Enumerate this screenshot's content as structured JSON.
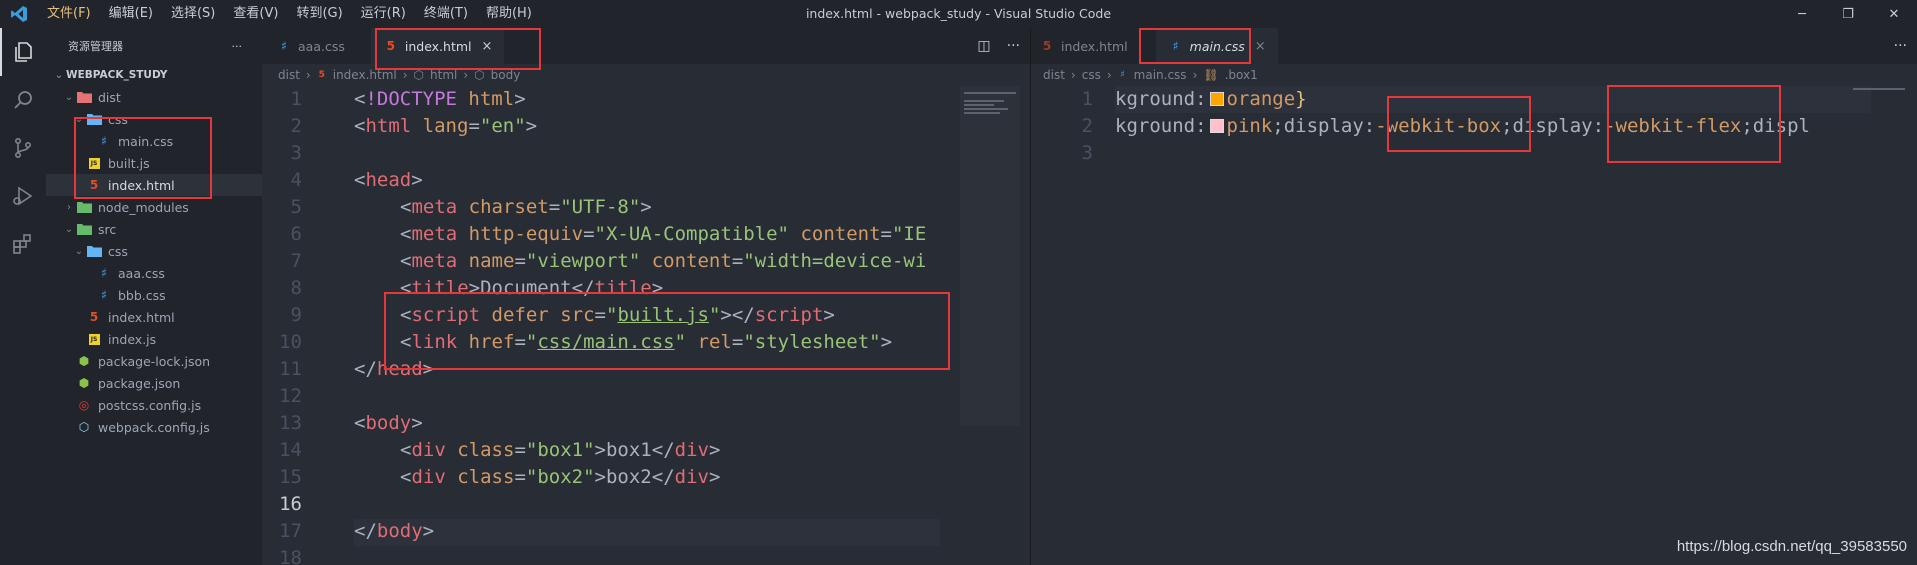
{
  "titlebar": {
    "menu": [
      "文件(F)",
      "编辑(E)",
      "选择(S)",
      "查看(V)",
      "转到(G)",
      "运行(R)",
      "终端(T)",
      "帮助(H)"
    ],
    "title": "index.html - webpack_study - Visual Studio Code"
  },
  "sidebar": {
    "header": "资源管理器",
    "more": "···",
    "folder": "WEBPACK_STUDY",
    "tree": [
      {
        "label": "dist",
        "indent": 1,
        "kind": "folder-open",
        "icon": "folder-red-icon"
      },
      {
        "label": "css",
        "indent": 2,
        "kind": "folder-open",
        "icon": "folder-blue-icon"
      },
      {
        "label": "main.css",
        "indent": 3,
        "kind": "css",
        "icon": "css-file-icon"
      },
      {
        "label": "built.js",
        "indent": 2,
        "kind": "js",
        "icon": "js-file-icon"
      },
      {
        "label": "index.html",
        "indent": 2,
        "kind": "html",
        "icon": "html-file-icon",
        "selected": true
      },
      {
        "label": "node_modules",
        "indent": 1,
        "kind": "folder-closed",
        "icon": "folder-green-icon"
      },
      {
        "label": "src",
        "indent": 1,
        "kind": "folder-open",
        "icon": "folder-green-icon"
      },
      {
        "label": "css",
        "indent": 2,
        "kind": "folder-open",
        "icon": "folder-blue-icon"
      },
      {
        "label": "aaa.css",
        "indent": 3,
        "kind": "css",
        "icon": "css-file-icon"
      },
      {
        "label": "bbb.css",
        "indent": 3,
        "kind": "css",
        "icon": "css-file-icon"
      },
      {
        "label": "index.html",
        "indent": 2,
        "kind": "html",
        "icon": "html-file-icon"
      },
      {
        "label": "index.js",
        "indent": 2,
        "kind": "js",
        "icon": "js-file-icon"
      },
      {
        "label": "package-lock.json",
        "indent": 1,
        "kind": "json",
        "icon": "npm-json-icon"
      },
      {
        "label": "package.json",
        "indent": 1,
        "kind": "json",
        "icon": "npm-json-icon"
      },
      {
        "label": "postcss.config.js",
        "indent": 1,
        "kind": "postcss",
        "icon": "postcss-icon"
      },
      {
        "label": "webpack.config.js",
        "indent": 1,
        "kind": "webpack",
        "icon": "webpack-icon"
      }
    ]
  },
  "editor_left": {
    "tabs": [
      {
        "label": "aaa.css",
        "active": false
      },
      {
        "label": "index.html",
        "active": true,
        "close": "×"
      }
    ],
    "breadcrumb": [
      "dist",
      "index.html",
      "html",
      "body"
    ],
    "lines": [
      "1",
      "2",
      "3",
      "4",
      "5",
      "6",
      "7",
      "8",
      "9",
      "10",
      "11",
      "12",
      "13",
      "14",
      "15",
      "16",
      "17",
      "18"
    ],
    "current_line": "16"
  },
  "editor_right": {
    "tabs": [
      {
        "label": "index.html",
        "active": false
      },
      {
        "label": "main.css",
        "active": true,
        "close": "×"
      }
    ],
    "breadcrumb": [
      "dist",
      "css",
      "main.css",
      ".box1"
    ],
    "lines": [
      "1",
      "2",
      "3"
    ]
  },
  "colors": {
    "accent_red": "#e5383b",
    "orange_swatch": "#ffa500",
    "pink_swatch": "#ffc0cb"
  },
  "watermark": "https://blog.csdn.net/qq_39583550"
}
